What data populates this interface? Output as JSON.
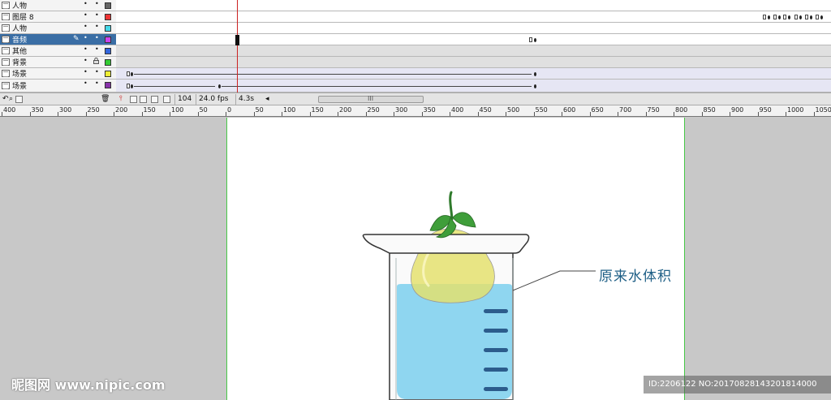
{
  "layers": [
    {
      "name": "人物",
      "color": "#666666"
    },
    {
      "name": "图层 8",
      "color": "#ee3333"
    },
    {
      "name": "人物",
      "color": "#44d8e8"
    },
    {
      "name": "音频",
      "color": "#cc44ee",
      "selected": true
    },
    {
      "name": "其他",
      "color": "#3366dd"
    },
    {
      "name": "背景",
      "color": "#33cc33",
      "locked": true
    },
    {
      "name": "场景",
      "color": "#eeee33"
    },
    {
      "name": "场景",
      "color": "#8833aa"
    }
  ],
  "toolbar": {
    "frame_number": "104",
    "frame_rate": "24.0 fps",
    "elapsed": "4.3s",
    "scroll_grip": "III"
  },
  "ruler": {
    "labels": [
      "400",
      "350",
      "300",
      "250",
      "200",
      "150",
      "100",
      "50",
      "0",
      "50",
      "100",
      "150",
      "200",
      "250",
      "300",
      "350",
      "400",
      "450",
      "500",
      "550",
      "600",
      "650",
      "700",
      "750",
      "800",
      "850",
      "900",
      "950",
      "1000",
      "1050"
    ]
  },
  "stage": {
    "annotation": "原来水体积",
    "colors": {
      "water": "#8fd6f0",
      "pear": "#e4e06a",
      "leaf": "#3f9e3a",
      "outline": "#333333",
      "leader_line": "#444444",
      "mark": "#2c5c8c"
    }
  },
  "watermark": {
    "left": "昵图网 www.nipic.com",
    "right": "ID:2206122 NO:20170828143201814000"
  }
}
